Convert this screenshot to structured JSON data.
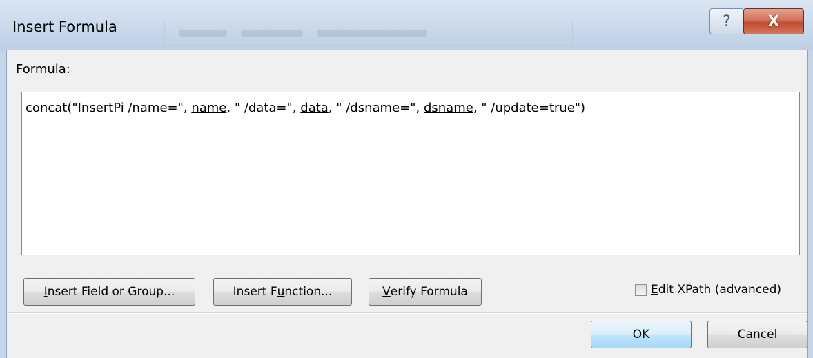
{
  "window": {
    "title": "Insert Formula",
    "help_label": "?",
    "close_label": "X"
  },
  "formula": {
    "label_mnemonic": "F",
    "label_rest": "ormula:",
    "parts": {
      "p1": "concat(\"InsertPi /name=\", ",
      "f1": "name",
      "p2": ", \" /data=\", ",
      "f2": "data",
      "p3": ", \" /dsname=\", ",
      "f3": "dsname",
      "p4": ", \" /update=true\")"
    }
  },
  "buttons": {
    "insert_field": {
      "mnemonic": "I",
      "rest": "nsert Field or Group..."
    },
    "insert_function": {
      "pre": "Insert F",
      "mnemonic": "u",
      "rest": "nction..."
    },
    "verify": {
      "mnemonic": "V",
      "rest": "erify Formula"
    },
    "ok": "OK",
    "cancel": "Cancel"
  },
  "edit_xpath": {
    "mnemonic": "E",
    "rest": "dit XPath (advanced)",
    "checked": false
  }
}
